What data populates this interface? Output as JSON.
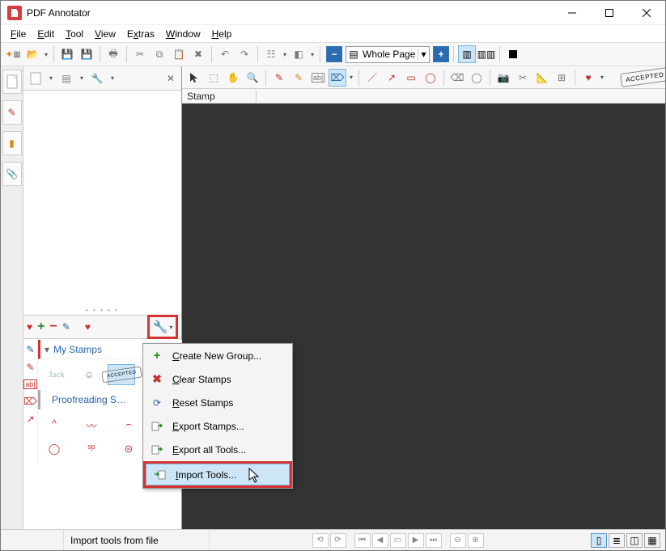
{
  "title": "PDF Annotator",
  "menus": {
    "file": "File",
    "edit": "Edit",
    "tool": "Tool",
    "view": "View",
    "extras": "Extras",
    "window": "Window",
    "help": "Help"
  },
  "zoom": {
    "label": "Whole Page"
  },
  "canvas": {
    "current_tool_label": "Stamp",
    "accepted_badge": "ACCEPTED"
  },
  "favorites_panel": {
    "group1_label": "My Stamps",
    "group2_label": "Proofreading S…",
    "jack_sig": "Jack"
  },
  "wrench_menu": {
    "create_group": "Create New Group...",
    "clear_stamps": "Clear Stamps",
    "reset_stamps": "Reset Stamps",
    "export_stamps": "Export Stamps...",
    "export_all": "Export all Tools...",
    "import_tools": "Import Tools..."
  },
  "status": {
    "hint": "Import tools from file"
  }
}
